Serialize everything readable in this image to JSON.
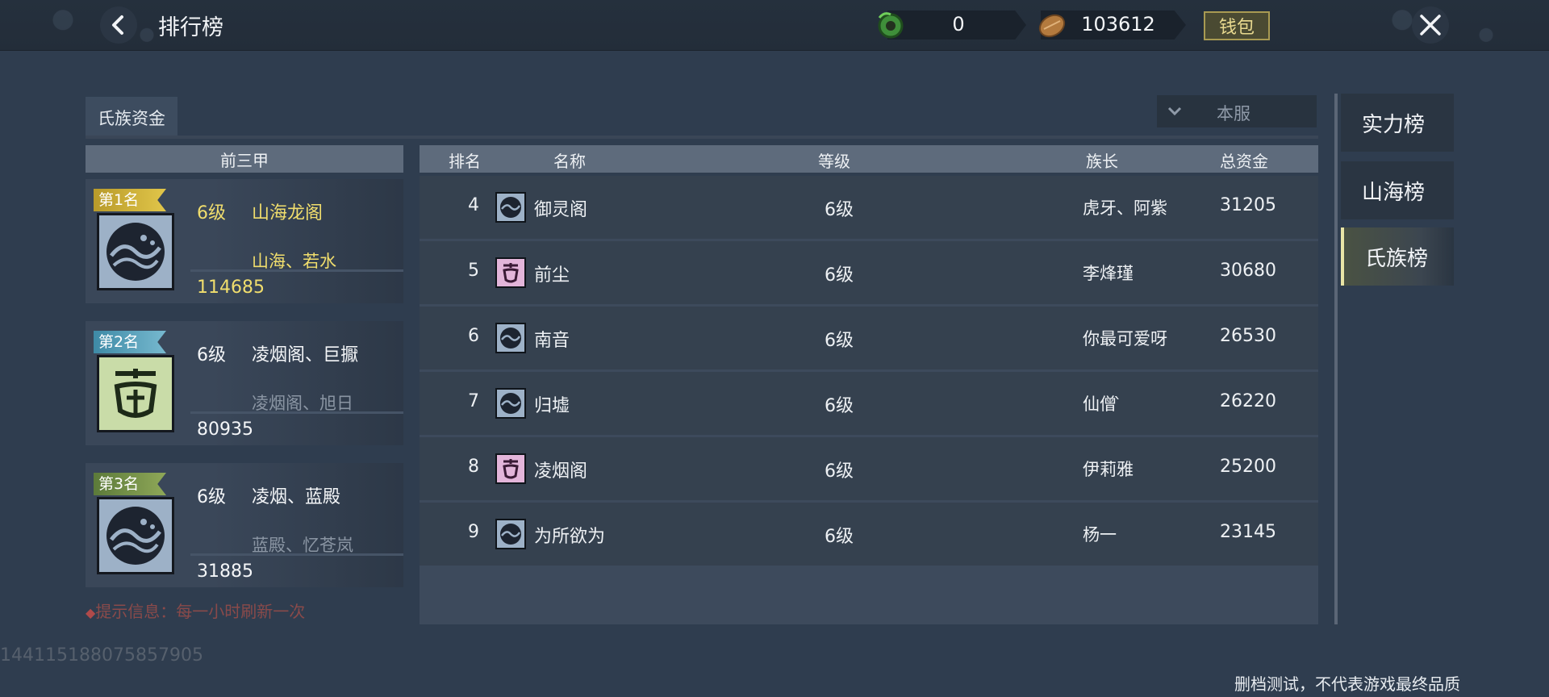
{
  "header": {
    "title": "排行榜",
    "jade_value": "0",
    "coin_value": "103612",
    "wallet_label": "钱包"
  },
  "tabs": {
    "active": "氏族资金"
  },
  "server_filter": {
    "selected": "本服"
  },
  "top_three": {
    "heading": "前三甲",
    "cards": [
      {
        "rank_label": "第1名",
        "level": "6级",
        "clan": "山海龙阁",
        "leaders": "山海、若水",
        "fund": "114685"
      },
      {
        "rank_label": "第2名",
        "level": "6级",
        "clan": "凌烟阁、巨擫",
        "leaders": "凌烟阁、旭日",
        "fund": "80935"
      },
      {
        "rank_label": "第3名",
        "level": "6级",
        "clan": "凌烟、蓝殿",
        "leaders": "蓝殿、忆苍岚",
        "fund": "31885"
      }
    ]
  },
  "table": {
    "headers": {
      "rank": "排名",
      "name": "名称",
      "level": "等级",
      "leader": "族长",
      "fund": "总资金"
    },
    "rows": [
      {
        "rank": "4",
        "name": "御灵阁",
        "level": "6级",
        "leader": "虎牙、阿紫",
        "fund": "31205",
        "icon": "wave-emblem-icon"
      },
      {
        "rank": "5",
        "name": "前尘",
        "level": "6级",
        "leader": "李烽瑾",
        "fund": "30680",
        "icon": "mask-emblem-icon"
      },
      {
        "rank": "6",
        "name": "南音",
        "level": "6级",
        "leader": "你最可爱呀",
        "fund": "26530",
        "icon": "wave-emblem-icon"
      },
      {
        "rank": "7",
        "name": "归墟",
        "level": "6级",
        "leader": "仙僧 ̀",
        "fund": "26220",
        "icon": "wave-emblem-icon"
      },
      {
        "rank": "8",
        "name": "凌烟阁",
        "level": "6级",
        "leader": "伊莉雅",
        "fund": "25200",
        "icon": "mask-emblem-icon"
      },
      {
        "rank": "9",
        "name": "为所欲为",
        "level": "6级",
        "leader": "杨一",
        "fund": "23145",
        "icon": "wave-emblem-icon"
      }
    ]
  },
  "right_tabs": [
    "实力榜",
    "山海榜",
    "氏族榜"
  ],
  "hint": "提示信息：每一小时刷新一次",
  "uid": "144115188075857905",
  "disclaimer": "删档测试，不代表游戏最终品质",
  "colors": {
    "gold_text": "#f1de6d",
    "active_tab_accent": "#e9e5a6",
    "background": "#2f3d4f"
  }
}
